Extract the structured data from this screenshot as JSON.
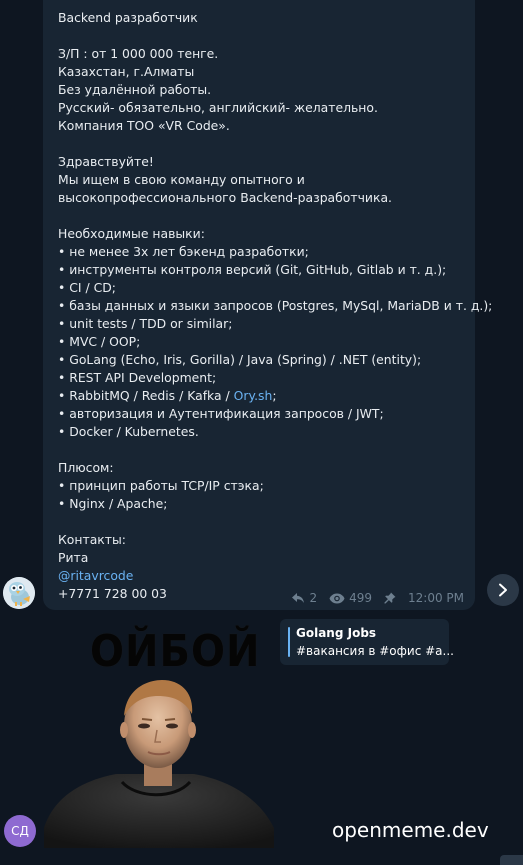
{
  "message": {
    "lines": [
      "Backend разработчик",
      "",
      "З/П : от 1 000 000 тенге.",
      "Казахстан, г.Алматы",
      "Без удалённой работы.",
      "Русский- обязательно, английский- желательно.",
      "Компания ТОО «VR Code».",
      "",
      "Здравствуйте!",
      "Мы ищем в свою команду опытного и",
      "высокопрофессионального Backend-разработчика.",
      "",
      "Необходимые навыки:",
      "• не менее 3х лет бэкенд разработки;",
      "• инструменты контроля версий (Git, GitHub, Gitlab и т. д.);",
      "• CI / CD;",
      "• базы данных и языки запросов (Postgres, MySql, MariaDB и т. д.);",
      "• unit tests / TDD or similar;",
      "• MVC / OOP;",
      "• GoLang (Echo, Iris, Gorilla) / Java (Spring) / .NET (entity);",
      "• REST API Development;",
      "• RabbitMQ / Redis / Kafka / ",
      "• авторизация и Аутентификация запросов / JWT;",
      "• Docker / Kubernetes.",
      "",
      "Плюсом:",
      "• принцип работы TCP/IP стэка;",
      "• Nginx / Apache;",
      "",
      "Контакты:",
      "Рита"
    ],
    "ory_link": "Ory.sh",
    "ory_suffix": ";",
    "contact_handle": "@ritavrcode",
    "contact_phone": "+7771 728 00 03",
    "replies": "2",
    "views": "499",
    "time": "12:00 PM"
  },
  "forward_card": {
    "title": "Golang Jobs",
    "subtitle": "#вакансия в #офис #а..."
  },
  "meme": {
    "caption": "ОЙБОЙ"
  },
  "sender_avatar": {
    "initials": "СД"
  },
  "watermark": "openmeme.dev",
  "colors": {
    "background": "#0e1621",
    "bubble": "#182533",
    "link": "#6ab2f2",
    "meta": "#6d7f8f",
    "avatar_sd": "#8e6ad1"
  },
  "icons": {
    "forward": "forward-arrow-icon",
    "reply": "reply-icon",
    "views": "eye-icon",
    "pin": "pin-icon"
  }
}
